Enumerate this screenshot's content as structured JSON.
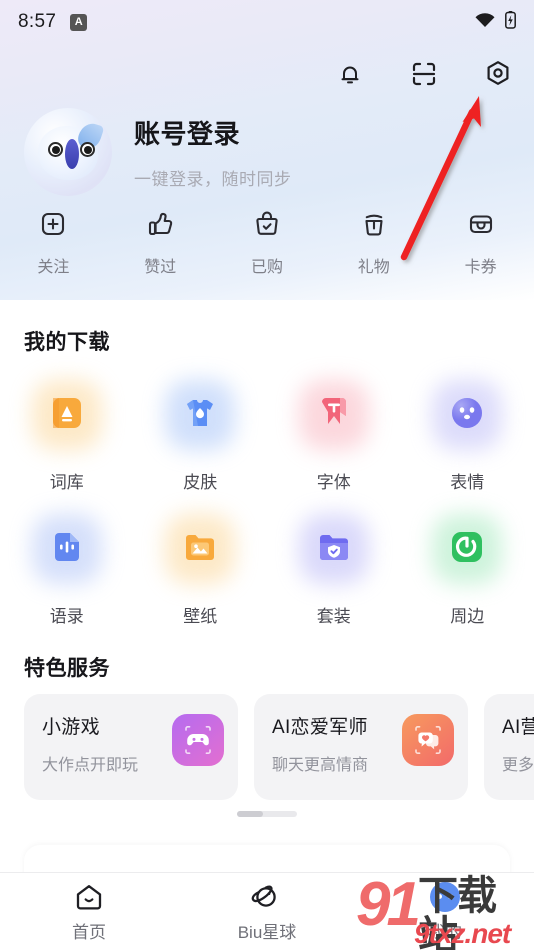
{
  "status_bar": {
    "time": "8:57",
    "badge": "A",
    "wifi_icon": "wifi-icon",
    "battery_icon": "battery-icon"
  },
  "topbar": {
    "icons": [
      {
        "name": "notification-bell-icon",
        "label": "通知"
      },
      {
        "name": "scan-icon",
        "label": "扫一扫"
      },
      {
        "name": "settings-hexagon-icon",
        "label": "设置"
      }
    ]
  },
  "profile": {
    "avatar_name": "user-avatar",
    "name": "账号登录",
    "subtitle": "一键登录，随时同步"
  },
  "quick_actions": [
    {
      "label": "关注",
      "icon": "plus-square-icon"
    },
    {
      "label": "赞过",
      "icon": "thumbs-up-icon"
    },
    {
      "label": "已购",
      "icon": "bag-check-icon"
    },
    {
      "label": "礼物",
      "icon": "gift-box-icon"
    },
    {
      "label": "卡券",
      "icon": "wallet-card-icon"
    }
  ],
  "downloads": {
    "title": "我的下载",
    "row1": [
      {
        "label": "词库",
        "icon": "dictionary-icon",
        "color": "#f8a93c",
        "glow": "#fbd79a"
      },
      {
        "label": "皮肤",
        "icon": "skin-shirt-icon",
        "color": "#5b8ef5",
        "glow": "#aac6f8"
      },
      {
        "label": "字体",
        "icon": "font-bookmark-icon",
        "color": "#f2657a",
        "glow": "#f9b7c1"
      },
      {
        "label": "表情",
        "icon": "emoji-face-icon",
        "color": "#7a78ee",
        "glow": "#c0bff7"
      }
    ],
    "row2": [
      {
        "label": "语录",
        "icon": "quotes-doc-icon",
        "color": "#6287f0",
        "glow": "#b3c6f7"
      },
      {
        "label": "壁纸",
        "icon": "wallpaper-folder-icon",
        "color": "#f8a93c",
        "glow": "#fbd79a"
      },
      {
        "label": "套装",
        "icon": "suite-folder-icon",
        "color": "#6f6bf0",
        "glow": "#bcbaf7"
      },
      {
        "label": "周边",
        "icon": "peripherals-power-icon",
        "color": "#2fc060",
        "glow": "#a6e9bf"
      }
    ]
  },
  "services": {
    "title": "特色服务",
    "cards": [
      {
        "title": "小游戏",
        "subtitle": "大作点开即玩",
        "icon": "gamepad-icon",
        "color_start": "#b56bf0",
        "color_end": "#e36fd0"
      },
      {
        "title": "AI恋爱军师",
        "subtitle": "聊天更高情商",
        "icon": "love-chat-icon",
        "color_start": "#f79a5e",
        "color_end": "#f26a6a"
      },
      {
        "title": "AI营销",
        "subtitle": "更多营",
        "icon": "marketing-icon",
        "color_start": "#f2c14e",
        "color_end": "#f28f4e"
      }
    ],
    "scroll_indicator": "carousel-scroll-indicator"
  },
  "bottom_nav": [
    {
      "label": "首页",
      "icon": "home-icon",
      "active": "false"
    },
    {
      "label": "Biu星球",
      "icon": "planet-icon",
      "active": "false"
    },
    {
      "label": "我的",
      "icon": "profile-avatar-icon",
      "active": "true"
    }
  ],
  "annotation": {
    "arrow_name": "red-pointer-arrow",
    "points_at": "settings-hexagon-icon",
    "color": "#ee2222"
  },
  "watermark": {
    "number": "91",
    "chinese": "下载站",
    "domain": "9txz.net"
  }
}
